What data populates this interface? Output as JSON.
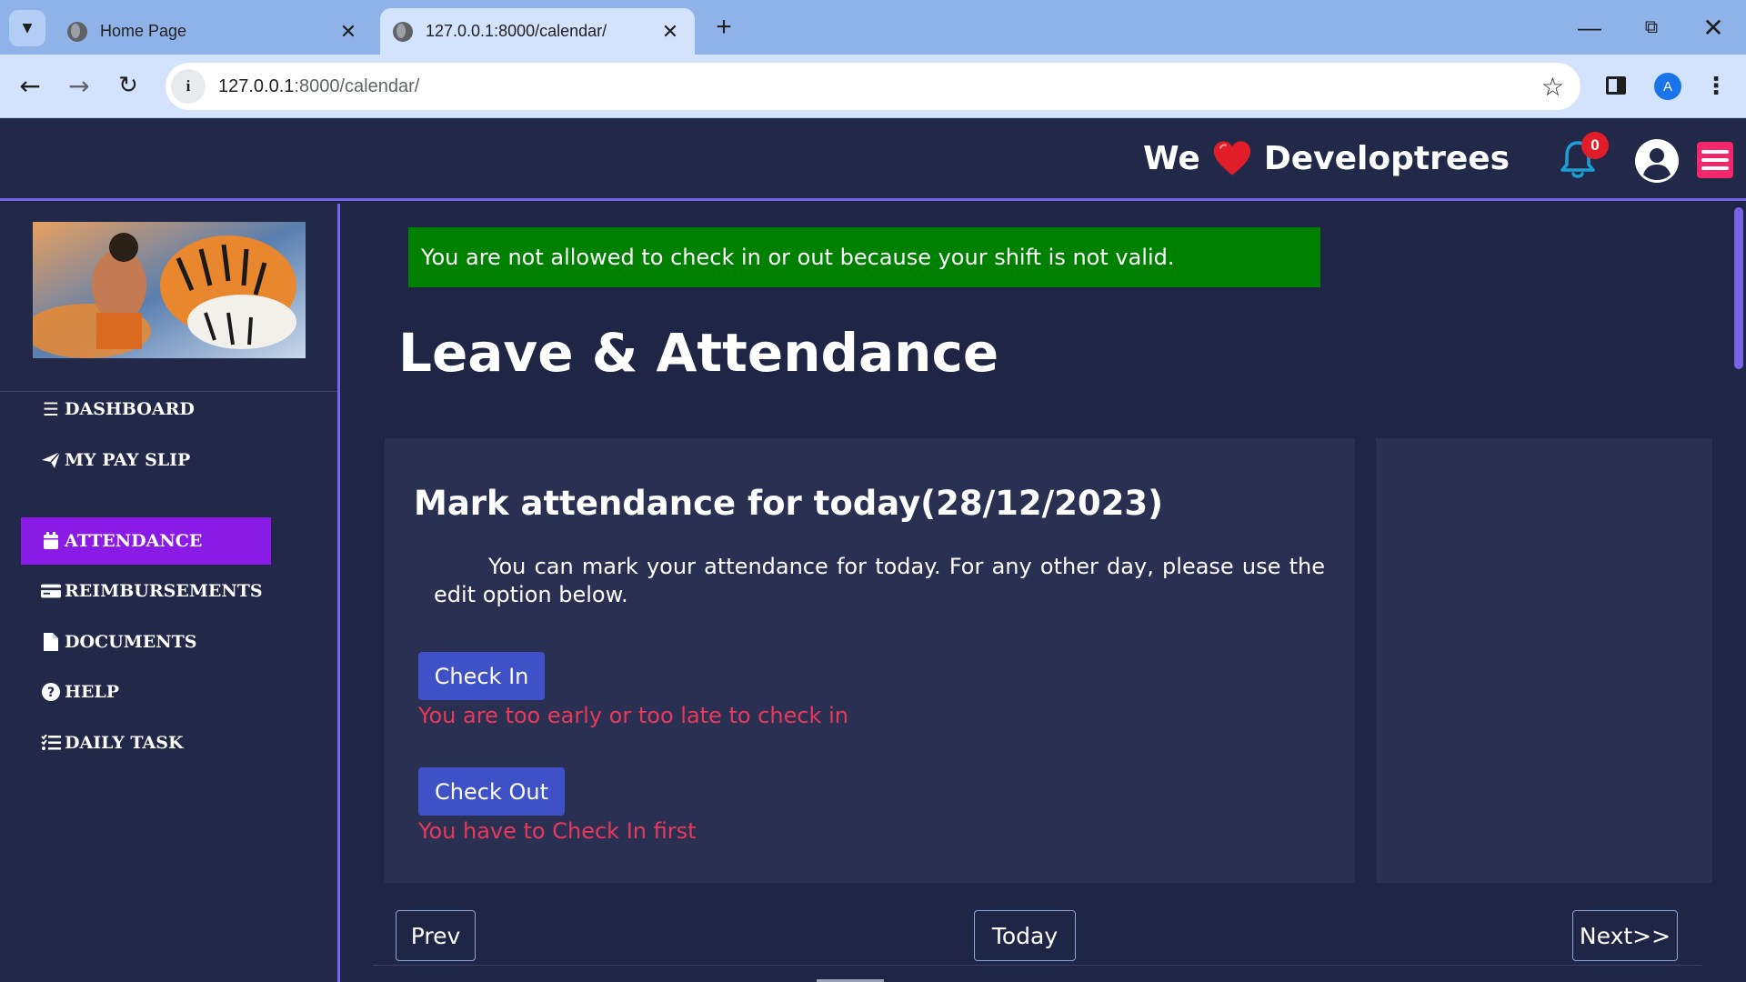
{
  "browser": {
    "tabs": [
      {
        "title": "Home Page",
        "active": false
      },
      {
        "title": "127.0.0.1:8000/calendar/",
        "active": true
      }
    ],
    "url_host": "127.0.0.1",
    "url_path": ":8000/calendar/",
    "profile_initial": "A"
  },
  "header": {
    "brand_left": "We",
    "brand_right": "Developtrees",
    "notification_count": "0",
    "colors": {
      "bar": "#212848",
      "accent": "#7a62e8",
      "menu": "#f2276e",
      "heart": "#e11d2a",
      "bell": "#1ea0d6"
    }
  },
  "sidebar": {
    "items": [
      {
        "label": "DASHBOARD",
        "icon": "bars-icon",
        "active": false
      },
      {
        "label": "MY PAY SLIP",
        "icon": "paper-plane-icon",
        "active": false
      },
      {
        "label": "ATTENDANCE",
        "icon": "calendar-icon",
        "active": true
      },
      {
        "label": "REIMBURSEMENTS",
        "icon": "credit-card-icon",
        "active": false
      },
      {
        "label": "DOCUMENTS",
        "icon": "file-icon",
        "active": false
      },
      {
        "label": "HELP",
        "icon": "question-circle-icon",
        "active": false
      },
      {
        "label": "DAILY TASK",
        "icon": "list-check-icon",
        "active": false
      }
    ],
    "active_color": "#8a1be6"
  },
  "main": {
    "alert": "You are not allowed to check in or out because your shift is not valid.",
    "title": "Leave & Attendance",
    "attendance": {
      "heading": "Mark attendance for today(28/12/2023)",
      "description": "You can mark your attendance for today. For any other day, please use the edit option below.",
      "check_in_label": "Check In",
      "check_in_error": "You are too early or too late to check in",
      "check_out_label": "Check Out",
      "check_out_error": "You have to Check In first"
    },
    "calendar_nav": {
      "prev": "Prev",
      "today": "Today",
      "next": "Next>>"
    }
  }
}
